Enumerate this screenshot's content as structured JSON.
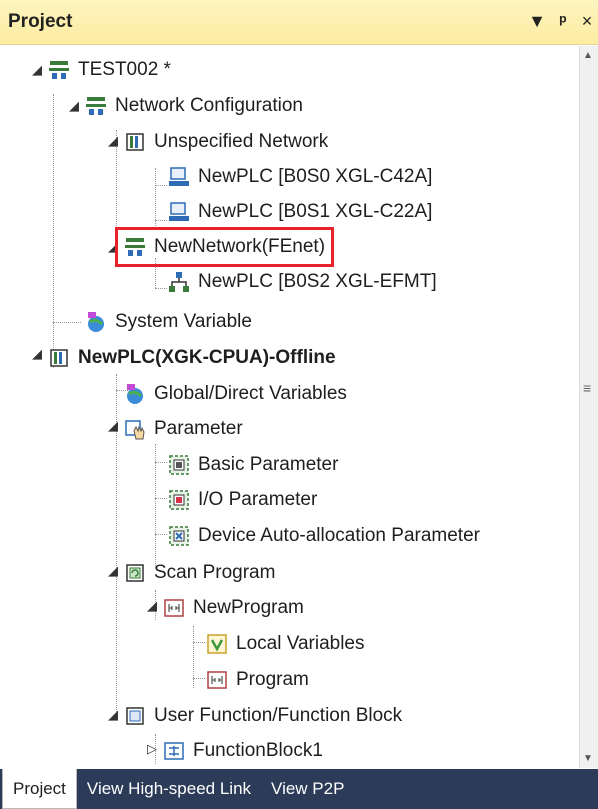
{
  "panel": {
    "title": "Project",
    "menu_icon": "dropdown-arrow-icon",
    "pin_glyph": "ꟷ",
    "close_glyph": "×"
  },
  "tree": {
    "root": "TEST002 *",
    "network_configuration": "Network Configuration",
    "unspecified_network": "Unspecified Network",
    "plc_b0s0": "NewPLC [B0S0 XGL-C42A]",
    "plc_b0s1": "NewPLC [B0S1 XGL-C22A]",
    "new_network": "NewNetwork(FEnet)",
    "plc_b0s2": "NewPLC [B0S2 XGL-EFMT]",
    "system_variable": "System Variable",
    "plc_offline": "NewPLC(XGK-CPUA)-Offline",
    "global_direct_variables": "Global/Direct Variables",
    "parameter": "Parameter",
    "basic_parameter": "Basic Parameter",
    "io_parameter": "I/O Parameter",
    "device_auto_allocation": "Device Auto-allocation Parameter",
    "scan_program": "Scan Program",
    "new_program": "NewProgram",
    "local_variables": "Local Variables",
    "program": "Program",
    "user_function_block": "User Function/Function Block",
    "function_block1": "FunctionBlock1"
  },
  "tabs": [
    "Project",
    "View High-speed Link",
    "View P2P"
  ],
  "colors": {
    "header_bg": "#fdeda1",
    "tab_bar_bg": "#2b3b58",
    "selection_border": "#e8212b"
  }
}
